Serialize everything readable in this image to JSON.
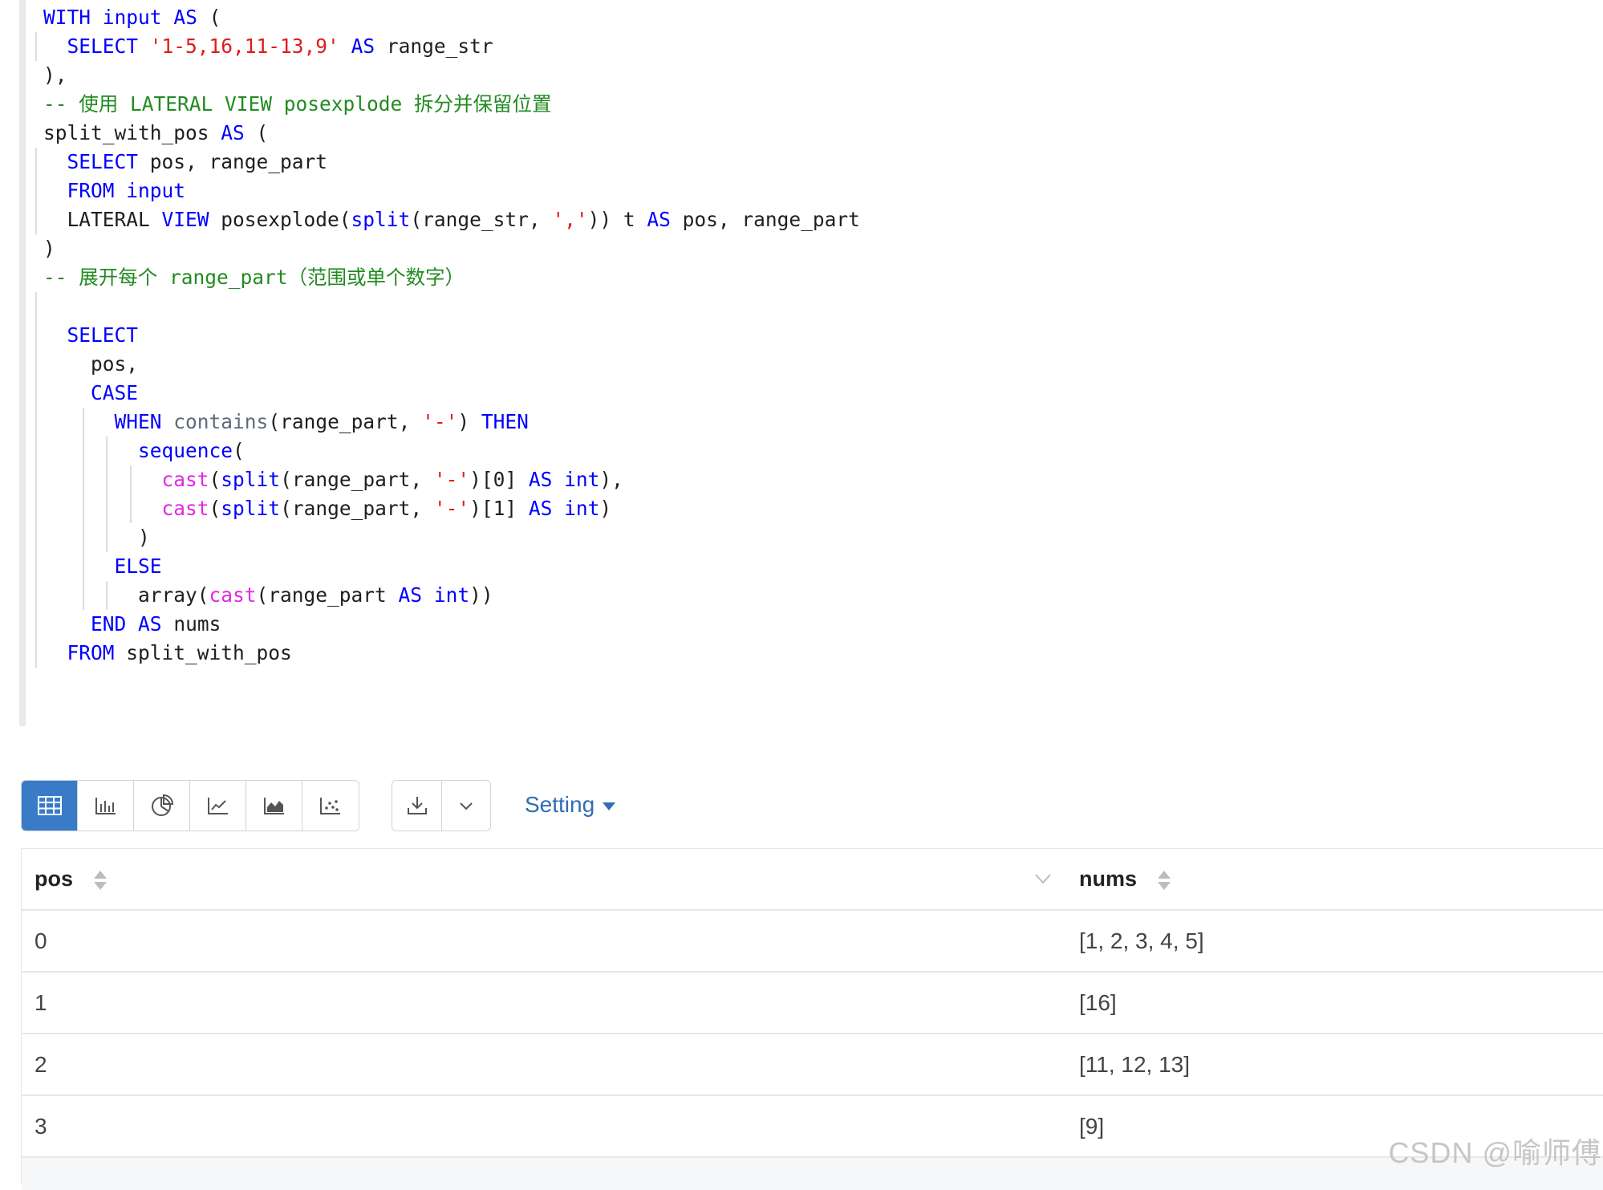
{
  "editor": {
    "lines": [
      {
        "guides": [],
        "tokens": [
          {
            "t": "WITH",
            "c": "kw"
          },
          {
            "t": " "
          },
          {
            "t": "input",
            "c": "kw"
          },
          {
            "t": " "
          },
          {
            "t": "AS",
            "c": "kw"
          },
          {
            "t": " ("
          }
        ]
      },
      {
        "guides": [
          0
        ],
        "tokens": [
          {
            "t": "  "
          },
          {
            "t": "SELECT",
            "c": "kw"
          },
          {
            "t": " "
          },
          {
            "t": "'1-5,16,11-13,9'",
            "c": "str"
          },
          {
            "t": " "
          },
          {
            "t": "AS",
            "c": "kw"
          },
          {
            "t": " range_str"
          }
        ]
      },
      {
        "guides": [],
        "tokens": [
          {
            "t": "),"
          }
        ]
      },
      {
        "guides": [],
        "tokens": [
          {
            "t": "-- 使用 LATERAL VIEW posexplode 拆分并保留位置",
            "c": "com"
          }
        ]
      },
      {
        "guides": [],
        "tokens": [
          {
            "t": "split_with_pos "
          },
          {
            "t": "AS",
            "c": "kw"
          },
          {
            "t": " ("
          }
        ]
      },
      {
        "guides": [
          0
        ],
        "tokens": [
          {
            "t": "  "
          },
          {
            "t": "SELECT",
            "c": "kw"
          },
          {
            "t": " pos, range_part"
          }
        ]
      },
      {
        "guides": [
          0
        ],
        "tokens": [
          {
            "t": "  "
          },
          {
            "t": "FROM",
            "c": "kw"
          },
          {
            "t": " "
          },
          {
            "t": "input",
            "c": "kw"
          }
        ]
      },
      {
        "guides": [
          0
        ],
        "tokens": [
          {
            "t": "  LATERAL "
          },
          {
            "t": "VIEW",
            "c": "kw"
          },
          {
            "t": " posexplode("
          },
          {
            "t": "split",
            "c": "fn"
          },
          {
            "t": "(range_str, "
          },
          {
            "t": "','",
            "c": "str"
          },
          {
            "t": ")) t "
          },
          {
            "t": "AS",
            "c": "kw"
          },
          {
            "t": " pos, range_part"
          }
        ]
      },
      {
        "guides": [],
        "tokens": [
          {
            "t": ")"
          }
        ]
      },
      {
        "guides": [],
        "tokens": [
          {
            "t": "-- 展开每个 range_part（范围或单个数字）",
            "c": "com"
          }
        ]
      },
      {
        "guides": [
          0
        ],
        "tokens": []
      },
      {
        "guides": [
          0
        ],
        "tokens": [
          {
            "t": "  "
          },
          {
            "t": "SELECT",
            "c": "kw"
          }
        ]
      },
      {
        "guides": [
          0
        ],
        "tokens": [
          {
            "t": "    pos,"
          }
        ]
      },
      {
        "guides": [
          0
        ],
        "tokens": [
          {
            "t": "    "
          },
          {
            "t": "CASE",
            "c": "kw"
          }
        ]
      },
      {
        "guides": [
          0,
          4
        ],
        "tokens": [
          {
            "t": "      "
          },
          {
            "t": "WHEN",
            "c": "kw"
          },
          {
            "t": " "
          },
          {
            "t": "contains",
            "c": "gray"
          },
          {
            "t": "(range_part, "
          },
          {
            "t": "'-'",
            "c": "str"
          },
          {
            "t": ") "
          },
          {
            "t": "THEN",
            "c": "kw"
          }
        ]
      },
      {
        "guides": [
          0,
          4,
          6
        ],
        "tokens": [
          {
            "t": "        "
          },
          {
            "t": "sequence",
            "c": "fn"
          },
          {
            "t": "("
          }
        ]
      },
      {
        "guides": [
          0,
          4,
          6,
          8
        ],
        "tokens": [
          {
            "t": "          "
          },
          {
            "t": "cast",
            "c": "cast"
          },
          {
            "t": "("
          },
          {
            "t": "split",
            "c": "fn"
          },
          {
            "t": "(range_part, "
          },
          {
            "t": "'-'",
            "c": "str"
          },
          {
            "t": ")[0] "
          },
          {
            "t": "AS",
            "c": "kw"
          },
          {
            "t": " "
          },
          {
            "t": "int",
            "c": "kw"
          },
          {
            "t": "),"
          }
        ]
      },
      {
        "guides": [
          0,
          4,
          6,
          8
        ],
        "tokens": [
          {
            "t": "          "
          },
          {
            "t": "cast",
            "c": "cast"
          },
          {
            "t": "("
          },
          {
            "t": "split",
            "c": "fn"
          },
          {
            "t": "(range_part, "
          },
          {
            "t": "'-'",
            "c": "str"
          },
          {
            "t": ")[1] "
          },
          {
            "t": "AS",
            "c": "kw"
          },
          {
            "t": " "
          },
          {
            "t": "int",
            "c": "kw"
          },
          {
            "t": ")"
          }
        ]
      },
      {
        "guides": [
          0,
          4,
          6
        ],
        "tokens": [
          {
            "t": "        )"
          }
        ]
      },
      {
        "guides": [
          0,
          4
        ],
        "tokens": [
          {
            "t": "      "
          },
          {
            "t": "ELSE",
            "c": "kw"
          }
        ]
      },
      {
        "guides": [
          0,
          4,
          6
        ],
        "tokens": [
          {
            "t": "        array("
          },
          {
            "t": "cast",
            "c": "cast"
          },
          {
            "t": "(range_part "
          },
          {
            "t": "AS",
            "c": "kw"
          },
          {
            "t": " "
          },
          {
            "t": "int",
            "c": "kw"
          },
          {
            "t": "))"
          }
        ]
      },
      {
        "guides": [
          0
        ],
        "tokens": [
          {
            "t": "    "
          },
          {
            "t": "END",
            "c": "kw"
          },
          {
            "t": " "
          },
          {
            "t": "AS",
            "c": "kw"
          },
          {
            "t": " nums"
          }
        ]
      },
      {
        "guides": [
          0
        ],
        "tokens": [
          {
            "t": "  "
          },
          {
            "t": "FROM",
            "c": "kw"
          },
          {
            "t": " split_with_pos"
          }
        ]
      }
    ]
  },
  "toolbar": {
    "view_buttons": [
      {
        "name": "table-view-button",
        "icon": "table-icon",
        "active": true
      },
      {
        "name": "bar-chart-button",
        "icon": "bar-chart-icon",
        "active": false
      },
      {
        "name": "pie-chart-button",
        "icon": "pie-chart-icon",
        "active": false
      },
      {
        "name": "line-chart-button",
        "icon": "line-chart-icon",
        "active": false
      },
      {
        "name": "area-chart-button",
        "icon": "area-chart-icon",
        "active": false
      },
      {
        "name": "scatter-chart-button",
        "icon": "scatter-chart-icon",
        "active": false
      }
    ],
    "download_icon": "download-icon",
    "dropdown_icon": "chevron-down-icon",
    "setting_label": "Setting",
    "accent_color": "#3a7bc8"
  },
  "table": {
    "columns": [
      "pos",
      "nums"
    ],
    "rows": [
      [
        "0",
        "[1, 2, 3, 4, 5]"
      ],
      [
        "1",
        "[16]"
      ],
      [
        "2",
        "[11, 12, 13]"
      ],
      [
        "3",
        "[9]"
      ]
    ]
  },
  "watermark": "CSDN @喻师傅"
}
